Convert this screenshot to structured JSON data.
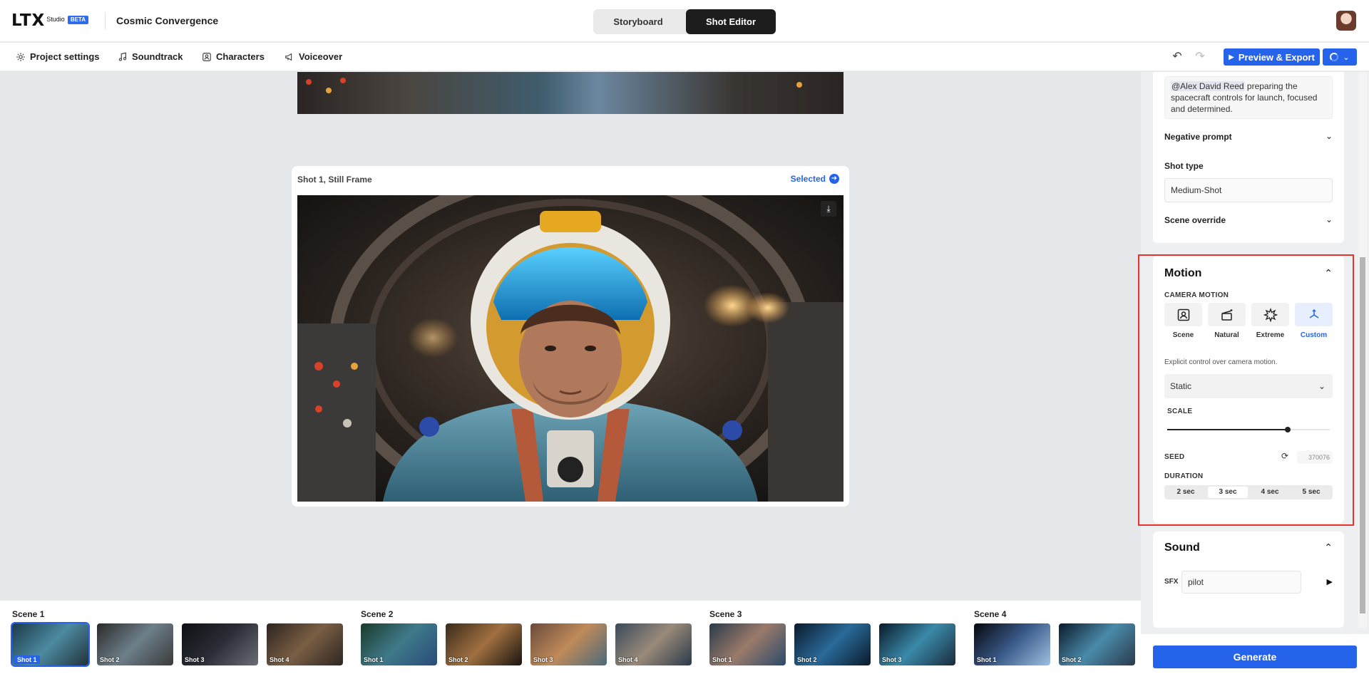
{
  "app": {
    "logo": "LTX",
    "logo_sub": "Studio",
    "badge": "BETA",
    "project_title": "Cosmic Convergence"
  },
  "mode": {
    "storyboard": "Storyboard",
    "shot_editor": "Shot Editor",
    "active": "Shot Editor"
  },
  "toolbar": {
    "project_settings": "Project settings",
    "soundtrack": "Soundtrack",
    "characters": "Characters",
    "voiceover": "Voiceover",
    "export": "Preview & Export"
  },
  "canvas": {
    "card_title": "Shot 1, Still Frame",
    "selected_label": "Selected"
  },
  "filmstrip": {
    "scenes": [
      {
        "label": "Scene 1",
        "shots": [
          "Shot 1",
          "Shot 2",
          "Shot 3",
          "Shot 4"
        ]
      },
      {
        "label": "Scene 2",
        "shots": [
          "Shot 1",
          "Shot 2",
          "Shot 3",
          "Shot 4"
        ]
      },
      {
        "label": "Scene 3",
        "shots": [
          "Shot 1",
          "Shot 2",
          "Shot 3"
        ]
      },
      {
        "label": "Scene 4",
        "shots": [
          "Shot 1",
          "Shot 2"
        ]
      }
    ],
    "active_scene": "Scene 1",
    "active_shot": "Shot 1"
  },
  "panel": {
    "prompt": {
      "mention": "@Alex David Reed",
      "text": " preparing the spacecraft controls for launch, focused and determined."
    },
    "negative_prompt": "Negative prompt",
    "shot_type_label": "Shot type",
    "shot_type_value": "Medium-Shot",
    "scene_override": "Scene override",
    "motion": {
      "title": "Motion",
      "camera_motion_label": "CAMERA MOTION",
      "options": [
        "Scene",
        "Natural",
        "Extreme",
        "Custom"
      ],
      "active_option": "Custom",
      "help": "Explicit control over camera motion.",
      "preset": "Static",
      "scale_label": "SCALE",
      "scale_value": 0.74,
      "seed_label": "SEED",
      "seed_value": "370076",
      "duration_label": "DURATION",
      "durations": [
        "2 sec",
        "3 sec",
        "4 sec",
        "5 sec"
      ],
      "active_duration": "3 sec"
    },
    "sound": {
      "title": "Sound",
      "sfx_label": "SFX",
      "sfx_value": "pilot"
    },
    "generate": "Generate"
  },
  "colors": {
    "accent": "#2563eb",
    "highlight_border": "#e8322c"
  }
}
